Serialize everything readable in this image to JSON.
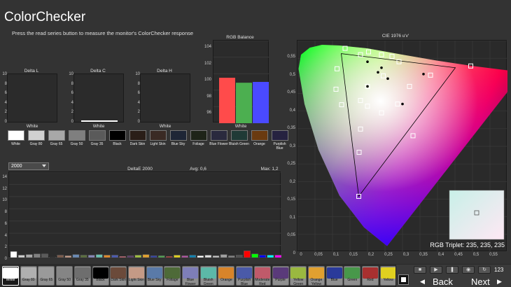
{
  "header": {
    "title": "ColorChecker",
    "subtitle": "Press the read series button to measure the monitor's ColorChecker response"
  },
  "delta_l": {
    "title": "Delta L",
    "ticks": [
      "10",
      "8",
      "6",
      "4",
      "2",
      "0"
    ],
    "swatch_label": "White",
    "value": 0
  },
  "delta_c": {
    "title": "Delta C",
    "ticks": [
      "10",
      "8",
      "6",
      "4",
      "2",
      "0"
    ],
    "swatch_label": "White",
    "value": 0.3
  },
  "delta_h": {
    "title": "Delta H",
    "ticks": [
      "10",
      "8",
      "6",
      "4",
      "2",
      "0"
    ],
    "swatch_label": "White",
    "value": 0
  },
  "rgb_balance": {
    "title": "RGB Balance",
    "ticks": [
      "104",
      "102",
      "100",
      "98",
      "96"
    ],
    "swatch_label": "White",
    "chart_data": {
      "type": "bar",
      "title": "RGB Balance",
      "categories": [
        "Red",
        "Green",
        "Blue"
      ],
      "values": [
        100.5,
        99.9,
        100.0
      ],
      "colors": [
        "#ff4b4b",
        "#4caf50",
        "#4a4aff"
      ],
      "ylim": [
        95,
        105
      ],
      "xlabel": "White"
    }
  },
  "swatches": [
    {
      "label": "White",
      "color": "#ffffff"
    },
    {
      "label": "Gray 80",
      "color": "#d0d0d0"
    },
    {
      "label": "Gray 65",
      "color": "#a8a8a8"
    },
    {
      "label": "Gray 50",
      "color": "#7f7f7f"
    },
    {
      "label": "Gray 35",
      "color": "#5a5a5a"
    },
    {
      "label": "Black",
      "color": "#000000"
    },
    {
      "label": "Dark Skin",
      "color": "#2a1e18"
    },
    {
      "label": "Light Skin",
      "color": "#3a2a24"
    },
    {
      "label": "Blue Sky",
      "color": "#1e2636"
    },
    {
      "label": "Foliage",
      "color": "#1e2418"
    },
    {
      "label": "Blue Flower",
      "color": "#2a2a3e"
    },
    {
      "label": "Bluish Green",
      "color": "#203a36"
    },
    {
      "label": "Orange",
      "color": "#6a3a10"
    },
    {
      "label": "Purplish Blue",
      "color": "#262240"
    }
  ],
  "deltae": {
    "dropdown_value": "2000",
    "title": "DeltaE 2000",
    "avg": "Avg: 0,6",
    "max": "Max: 1,2",
    "ticks": [
      "14",
      "12",
      "10",
      "8",
      "6",
      "4",
      "2",
      "0"
    ],
    "chart_data": {
      "type": "bar",
      "title": "DeltaE 2000",
      "ylim": [
        0,
        14
      ],
      "values": [
        1.0,
        0.4,
        0.5,
        0.6,
        0.6,
        0.1,
        0.4,
        0.3,
        0.5,
        0.4,
        0.4,
        0.5,
        0.4,
        0.4,
        0.2,
        0.3,
        0.4,
        0.5,
        0.3,
        0.3,
        0.2,
        0.4,
        0.3,
        0.4,
        0.3,
        0.4,
        0.3,
        0.5,
        0.3,
        0.4,
        1.1,
        0.6,
        0.4,
        0.4,
        0.4
      ],
      "colors": [
        "#ffffff",
        "#cfcfcf",
        "#a8a8a8",
        "#808080",
        "#5a5a5a",
        "#000000",
        "#7a5a4a",
        "#c49a86",
        "#6a8ab4",
        "#5a6e3e",
        "#8686b8",
        "#6ac0b0",
        "#e08a2a",
        "#4a5ab0",
        "#c05a6a",
        "#5a3a6a",
        "#a0c040",
        "#e0a030",
        "#3040a0",
        "#50a050",
        "#b03030",
        "#e0d020",
        "#b050a0",
        "#1080b0",
        "#ffffff",
        "#e0e0e0",
        "#c0c0c0",
        "#a0a0a0",
        "#808080",
        "#505050",
        "#ff0000",
        "#00ff00",
        "#0000ff",
        "#00ffff",
        "#ff00ff"
      ]
    }
  },
  "cie": {
    "title": "CIE 1976 u'v'",
    "y_ticks": [
      "0,55",
      "0,5",
      "0,45",
      "0,4",
      "0,35",
      "0,3",
      "0,25",
      "0,2",
      "0,15",
      "0,1",
      "0,05",
      "0"
    ],
    "x_ticks": [
      "0",
      "0,05",
      "0,1",
      "0,15",
      "0,2",
      "0,25",
      "0,3",
      "0,35",
      "0,4",
      "0,45",
      "0,5",
      "0,55"
    ],
    "rgb_triplet": "RGB Triplet: 235, 235, 235",
    "chart_data": {
      "type": "scatter",
      "title": "CIE 1976 u'v'",
      "xlim": [
        0,
        0.6
      ],
      "ylim": [
        0,
        0.6
      ],
      "gamut_triangle": [
        [
          0.451,
          0.523
        ],
        [
          0.125,
          0.563
        ],
        [
          0.175,
          0.158
        ]
      ],
      "targets": [
        [
          0.136,
          0.578
        ],
        [
          0.18,
          0.56
        ],
        [
          0.203,
          0.568
        ],
        [
          0.24,
          0.56
        ],
        [
          0.27,
          0.555
        ],
        [
          0.29,
          0.54
        ],
        [
          0.38,
          0.502
        ],
        [
          0.495,
          0.528
        ],
        [
          0.113,
          0.52
        ],
        [
          0.2,
          0.47
        ],
        [
          0.245,
          0.5
        ],
        [
          0.11,
          0.462
        ],
        [
          0.126,
          0.418
        ],
        [
          0.18,
          0.43
        ],
        [
          0.2,
          0.414
        ],
        [
          0.24,
          0.395
        ],
        [
          0.286,
          0.42
        ],
        [
          0.32,
          0.47
        ],
        [
          0.18,
          0.349
        ],
        [
          0.176,
          0.283
        ],
        [
          0.33,
          0.33
        ],
        [
          0.175,
          0.158
        ]
      ],
      "measured": [
        [
          0.2,
          0.47
        ],
        [
          0.23,
          0.51
        ],
        [
          0.258,
          0.492
        ],
        [
          0.36,
          0.505
        ],
        [
          0.2,
          0.54
        ],
        [
          0.24,
          0.523
        ],
        [
          0.3,
          0.42
        ]
      ]
    }
  },
  "bottom_patches": [
    {
      "label": "White",
      "color": "#ffffff",
      "bg": "#cfcfcf"
    },
    {
      "label": "Gray 80",
      "color": "#b0b0b0",
      "bg": "#8f8f8f"
    },
    {
      "label": "Gray 65",
      "color": "#9a9a9a",
      "bg": "#8f8f8f"
    },
    {
      "label": "Gray 50",
      "color": "#858585",
      "bg": "#8f8f8f"
    },
    {
      "label": "Gray 35",
      "color": "#6e6e6e",
      "bg": "#8f8f8f"
    },
    {
      "label": "Black",
      "color": "#000000",
      "bg": "#8f8f8f"
    },
    {
      "label": "Dark Skin",
      "color": "#6b4a3a",
      "bg": "#8f8f8f"
    },
    {
      "label": "Light Skin",
      "color": "#c49a86",
      "bg": "#8f8f8f"
    },
    {
      "label": "Blue Sky",
      "color": "#5a7aa8",
      "bg": "#8f8f8f"
    },
    {
      "label": "Foliage",
      "color": "#4e6a38",
      "bg": "#8f8f8f"
    },
    {
      "label": "Blue Flower",
      "color": "#7e7eb8",
      "bg": "#8f8f8f"
    },
    {
      "label": "Bluish Green",
      "color": "#5cb8a8",
      "bg": "#8f8f8f"
    },
    {
      "label": "Orange",
      "color": "#d8842a",
      "bg": "#8f8f8f"
    },
    {
      "label": "Purplish Blue",
      "color": "#4a5aa8",
      "bg": "#8f8f8f"
    },
    {
      "label": "Moderate Red",
      "color": "#c05a6a",
      "bg": "#8f8f8f"
    },
    {
      "label": "Purple",
      "color": "#5a3a7a",
      "bg": "#8f8f8f"
    },
    {
      "label": "Yellow Green",
      "color": "#9ab840",
      "bg": "#8f8f8f"
    },
    {
      "label": "Orange Yellow",
      "color": "#e0a030",
      "bg": "#8f8f8f"
    },
    {
      "label": "Blue",
      "color": "#2a3a9a",
      "bg": "#8f8f8f"
    },
    {
      "label": "Green",
      "color": "#48984a",
      "bg": "#8f8f8f"
    },
    {
      "label": "Red",
      "color": "#a83030",
      "bg": "#8f8f8f"
    },
    {
      "label": "Yellow",
      "color": "#e0d020",
      "bg": "#8f8f8f"
    }
  ],
  "controls": {
    "back": "Back",
    "next": "Next",
    "counter": "123"
  }
}
